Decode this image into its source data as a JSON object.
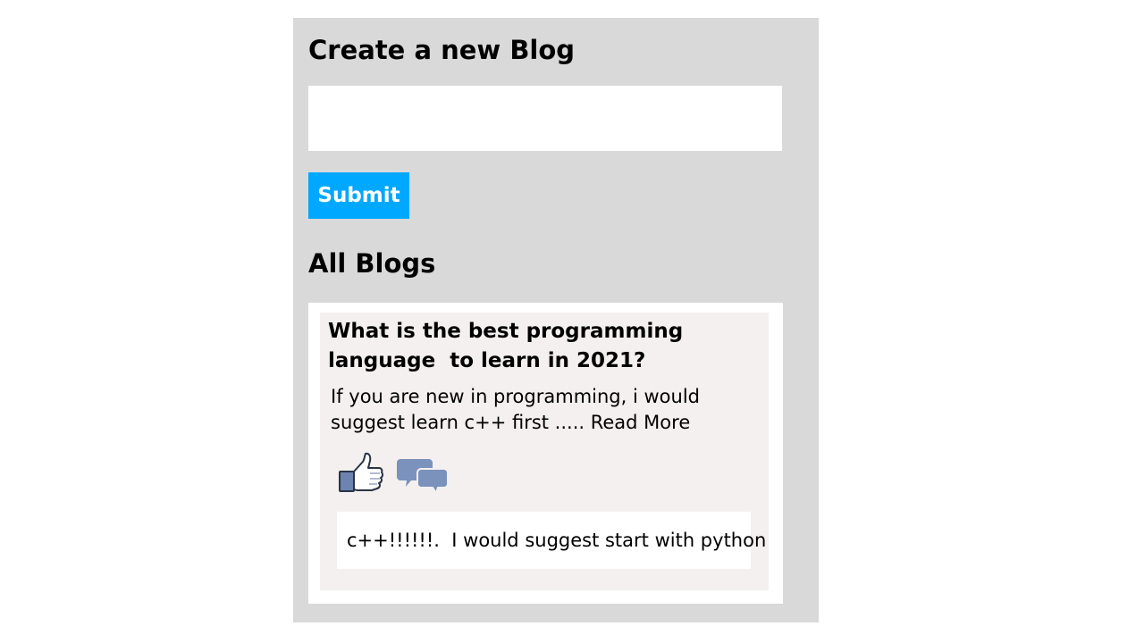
{
  "create": {
    "title": "Create a new Blog",
    "input_value": "",
    "submit_label": "Submit"
  },
  "blogs": {
    "title": "All Blogs",
    "items": [
      {
        "title": "What is the best programming language  to learn in 2021?",
        "excerpt": "If you are new in programming, i would suggest learn c++ first ..... ",
        "read_more": "Read More",
        "like_icon": "thumbs-up-icon",
        "comment_icon": "speech-bubbles-icon",
        "comments": [
          {
            "text": "c++!!!!!!.  I would suggest start with python"
          }
        ]
      }
    ]
  },
  "colors": {
    "panel_bg": "#d9d9d9",
    "submit_bg": "#00a8ff",
    "card_bg": "#f4f0ef",
    "icon_blue": "#7b92bd"
  }
}
